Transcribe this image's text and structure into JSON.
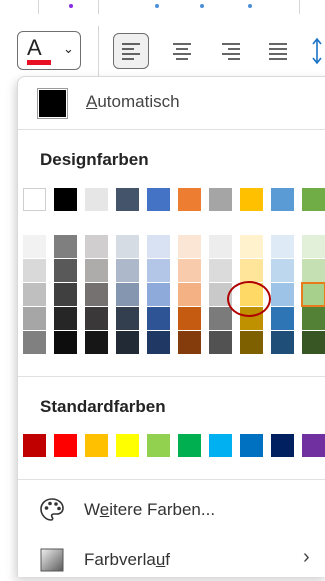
{
  "ribbon": {
    "font_color_letter": "A",
    "font_color_bar": "#e81123",
    "buttons": [
      "align-left",
      "align-center",
      "align-right",
      "align-justify",
      "line-spacing"
    ]
  },
  "color_menu": {
    "automatic": {
      "label_prefix": "",
      "label_underlined": "A",
      "label_rest": "utomatisch",
      "color": "#000000"
    },
    "theme_colors_title": "Designfarben",
    "theme_base": [
      "#ffffff",
      "#000000",
      "#e7e6e6",
      "#44546a",
      "#4472c4",
      "#ed7d31",
      "#a5a5a5",
      "#ffc000",
      "#5b9bd5",
      "#70ad47"
    ],
    "theme_shades": [
      [
        "#f2f2f2",
        "#d9d9d9",
        "#bfbfbf",
        "#a6a6a6",
        "#808080"
      ],
      [
        "#7f7f7f",
        "#595959",
        "#404040",
        "#262626",
        "#0d0d0d"
      ],
      [
        "#d0cece",
        "#aeabab",
        "#757171",
        "#3a3838",
        "#171616"
      ],
      [
        "#d6dce4",
        "#adb9ca",
        "#8496b0",
        "#333f4f",
        "#222a35"
      ],
      [
        "#d9e2f3",
        "#b4c6e7",
        "#8eaadb",
        "#2f5496",
        "#1f3864"
      ],
      [
        "#fbe5d5",
        "#f7cbac",
        "#f4b183",
        "#c55a11",
        "#843c0c"
      ],
      [
        "#ededed",
        "#dbdbdb",
        "#c9c9c9",
        "#7b7b7b",
        "#525252"
      ],
      [
        "#fff2cc",
        "#fee599",
        "#ffd966",
        "#bf9000",
        "#7f6000"
      ],
      [
        "#deebf6",
        "#bdd7ee",
        "#9dc3e6",
        "#2e75b5",
        "#1f4e79"
      ],
      [
        "#e2efd9",
        "#c5e0b3",
        "#a8d08d",
        "#538135",
        "#375623"
      ]
    ],
    "selected_swatch": "#a8d08d",
    "standard_colors_title": "Standardfarben",
    "standard": [
      "#c00000",
      "#ff0000",
      "#ffc000",
      "#ffff00",
      "#92d050",
      "#00b050",
      "#00b0f0",
      "#0070c0",
      "#002060",
      "#7030a0"
    ],
    "more_colors": {
      "label_prefix": "W",
      "label_underlined": "e",
      "label_rest": "itere Farben...",
      "icon": "palette-icon"
    },
    "gradient": {
      "label_prefix": "Farbverla",
      "label_underlined": "u",
      "label_rest": "f",
      "icon": "gradient-icon",
      "submenu_icon": "chevron-right-icon"
    }
  }
}
